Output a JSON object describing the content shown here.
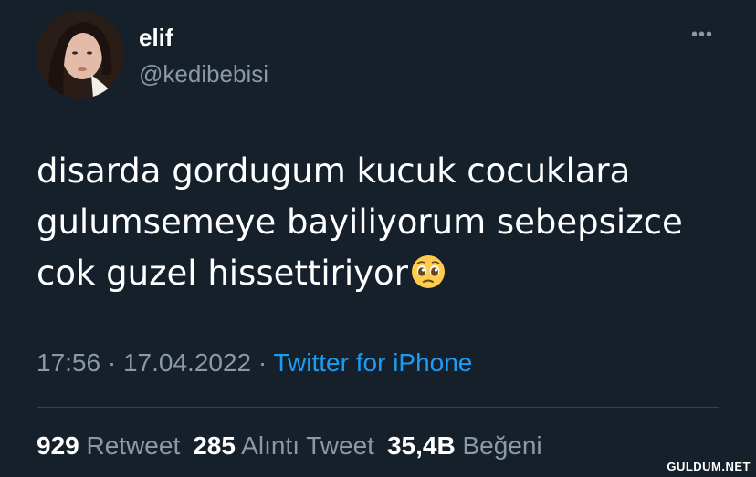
{
  "user": {
    "display_name": "elif",
    "handle": "@kedibebisi"
  },
  "menu": {
    "more_label": "•••"
  },
  "tweet": {
    "lines": [
      "disarda gordugum kucuk cocuklara",
      "gulumsemeye bayiliyorum sebepsizce",
      "cok guzel hissettiriyor"
    ],
    "emoji_icon": "pleading-face-icon"
  },
  "meta": {
    "time": "17:56",
    "sep1": " · ",
    "date": "17.04.2022",
    "sep2": " · ",
    "source": "Twitter for iPhone"
  },
  "stats": {
    "retweets_count": "929",
    "retweets_label": "Retweet",
    "quotes_count": "285",
    "quotes_label": "Alıntı Tweet",
    "likes_count": "35,4B",
    "likes_label": "Beğeni"
  },
  "watermark": "GULDUM.NET",
  "colors": {
    "background": "#15202b",
    "text": "#ffffff",
    "secondary": "#8b98a5",
    "link": "#1d9bf0"
  }
}
